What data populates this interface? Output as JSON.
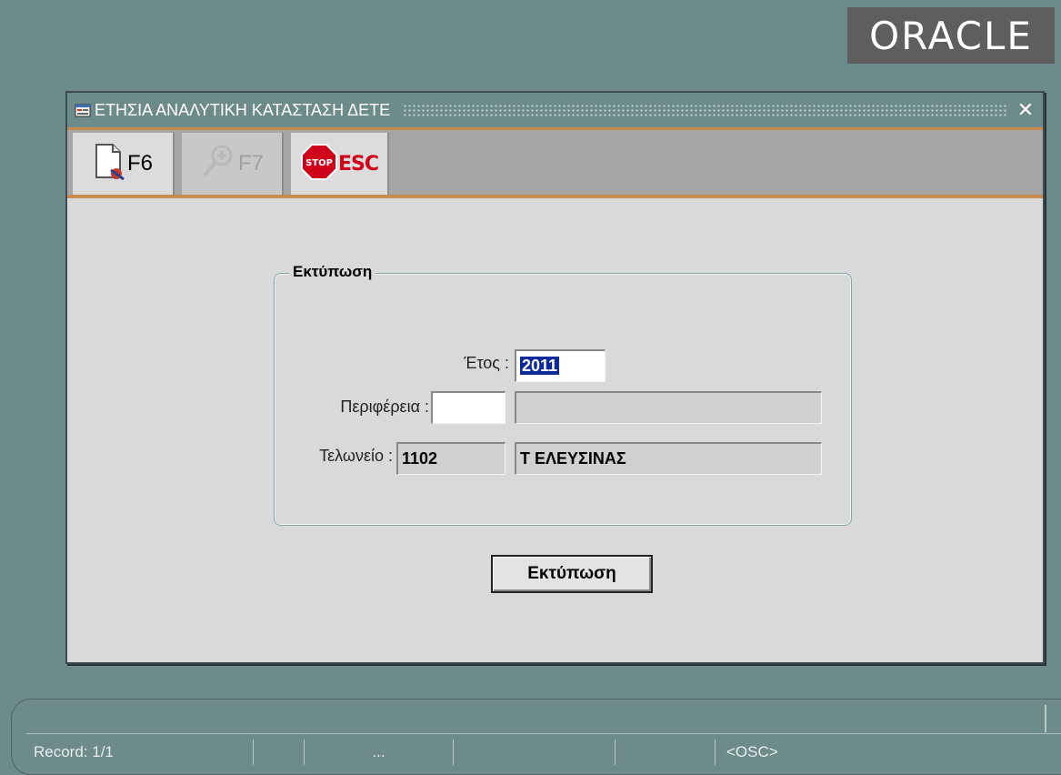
{
  "brand": {
    "logo_text": "ORACLE"
  },
  "window": {
    "title": "ΕΤΗΣΙΑ ΑΝΑΛΥΤΙΚΗ ΚΑΤΑΣΤΑΣΗ ΔΕΤΕ",
    "close_label": "✕"
  },
  "toolbar": {
    "new_label": "F6",
    "query_label": "F7",
    "exit_label": "ESC",
    "stop_text": "STOP"
  },
  "form": {
    "frame_title": "Εκτύπωση",
    "year_label": "Έτος :",
    "year_value": "2011",
    "region_label": "Περιφέρεια :",
    "region_code": "",
    "region_name": "",
    "customs_label": "Τελωνείο :",
    "customs_code": "1102",
    "customs_name": "Τ ΕΛΕΥΣΙΝΑΣ",
    "print_button": "Εκτύπωση"
  },
  "status": {
    "record": "Record: 1/1",
    "ellipsis": "...",
    "mode": "<OSC>"
  },
  "colors": {
    "desktop": "#6d8b8a",
    "window_bg": "#d9d9d9",
    "toolbar_accent": "#c98a4f",
    "selection": "#0a2a9e"
  }
}
